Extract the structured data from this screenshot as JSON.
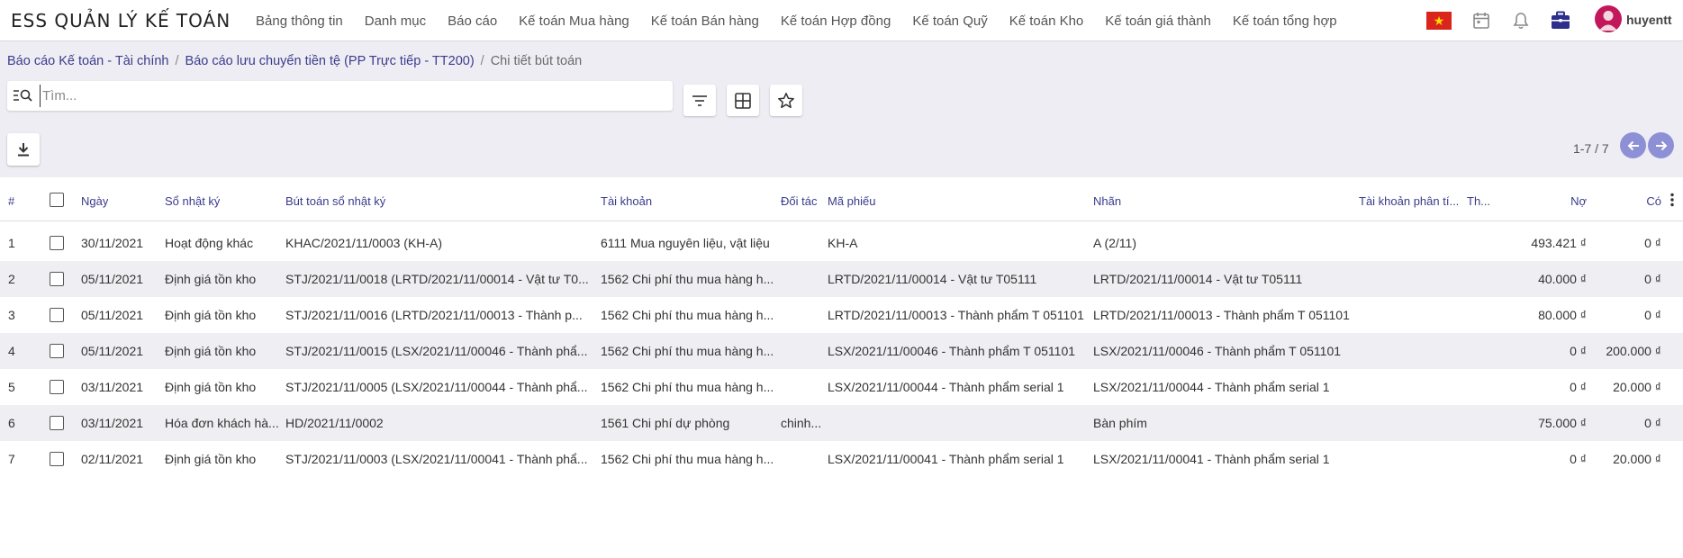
{
  "app": {
    "title": "ESS QUẢN LÝ KẾ TOÁN",
    "username": "huyentt"
  },
  "menu": [
    "Bảng thông tin",
    "Danh mục",
    "Báo cáo",
    "Kế toán Mua hàng",
    "Kế toán Bán hàng",
    "Kế toán Hợp đồng",
    "Kế toán Quỹ",
    "Kế toán Kho",
    "Kế toán giá thành",
    "Kế toán tổng hợp"
  ],
  "icons": {
    "flag": "vietnam-flag-icon",
    "calendar": "calendar-icon",
    "bell": "bell-icon",
    "briefcase": "briefcase-icon",
    "avatar": "user-avatar-icon"
  },
  "colors": {
    "link": "#3c3c8e",
    "pager": "#8e90d6",
    "briefcase": "#2d2d8c",
    "avatar": "#c2185b",
    "flag": "#da251d"
  },
  "breadcrumb": {
    "items": [
      "Báo cáo Kế toán - Tài chính",
      "Báo cáo lưu chuyển tiền tệ (PP Trực tiếp - TT200)"
    ],
    "current": "Chi tiết bút toán",
    "sep": "/"
  },
  "search": {
    "placeholder": "Tìm...",
    "value": ""
  },
  "toolbar": {
    "filter": "filter-icon",
    "group": "grid-icon",
    "favorite": "star-icon",
    "download": "download-icon"
  },
  "pager": {
    "text": "1-7 / 7"
  },
  "table": {
    "headers": {
      "idx": "#",
      "date": "Ngày",
      "journal": "Sổ nhật ký",
      "entry": "Bút toán sổ nhật ký",
      "account": "Tài khoản",
      "partner": "Đối tác",
      "ref": "Mã phiếu",
      "label": "Nhãn",
      "analytic": "Tài khoản phân tí...",
      "tax": "Th...",
      "debit": "Nợ",
      "credit": "Có"
    },
    "rows": [
      {
        "idx": "1",
        "date": "30/11/2021",
        "journal": "Hoạt động khác",
        "entry": "KHAC/2021/11/0003 (KH-A)",
        "account": "6111 Mua nguyên liệu, vật liệu",
        "partner": "",
        "ref": "KH-A",
        "label": "A (2/11)",
        "debit": "493.421 ₫",
        "credit": "0 ₫"
      },
      {
        "idx": "2",
        "date": "05/11/2021",
        "journal": "Định giá tồn kho",
        "entry": "STJ/2021/11/0018 (LRTD/2021/11/00014 - Vật tư T0...",
        "account": "1562 Chi phí thu mua hàng h...",
        "partner": "",
        "ref": "LRTD/2021/11/00014 - Vật tư T05111",
        "label": "LRTD/2021/11/00014 - Vật tư T05111",
        "debit": "40.000 ₫",
        "credit": "0 ₫"
      },
      {
        "idx": "3",
        "date": "05/11/2021",
        "journal": "Định giá tồn kho",
        "entry": "STJ/2021/11/0016 (LRTD/2021/11/00013 - Thành p...",
        "account": "1562 Chi phí thu mua hàng h...",
        "partner": "",
        "ref": "LRTD/2021/11/00013 - Thành phẩm T 051101",
        "label": "LRTD/2021/11/00013 - Thành phẩm T 051101",
        "debit": "80.000 ₫",
        "credit": "0 ₫"
      },
      {
        "idx": "4",
        "date": "05/11/2021",
        "journal": "Định giá tồn kho",
        "entry": "STJ/2021/11/0015 (LSX/2021/11/00046 - Thành phẩ...",
        "account": "1562 Chi phí thu mua hàng h...",
        "partner": "",
        "ref": "LSX/2021/11/00046 - Thành phẩm T 051101",
        "label": "LSX/2021/11/00046 - Thành phẩm T 051101",
        "debit": "0 ₫",
        "credit": "200.000 ₫"
      },
      {
        "idx": "5",
        "date": "03/11/2021",
        "journal": "Định giá tồn kho",
        "entry": "STJ/2021/11/0005 (LSX/2021/11/00044 - Thành phẩ...",
        "account": "1562 Chi phí thu mua hàng h...",
        "partner": "",
        "ref": "LSX/2021/11/00044 - Thành phẩm serial 1",
        "label": "LSX/2021/11/00044 - Thành phẩm serial 1",
        "debit": "0 ₫",
        "credit": "20.000 ₫"
      },
      {
        "idx": "6",
        "date": "03/11/2021",
        "journal": "Hóa đơn khách hà...",
        "entry": "HD/2021/11/0002",
        "account": "1561 Chi phí dự phòng",
        "partner": "chinh...",
        "ref": "",
        "label": "Bàn phím",
        "debit": "75.000 ₫",
        "credit": "0 ₫"
      },
      {
        "idx": "7",
        "date": "02/11/2021",
        "journal": "Định giá tồn kho",
        "entry": "STJ/2021/11/0003 (LSX/2021/11/00041 - Thành phẩ...",
        "account": "1562 Chi phí thu mua hàng h...",
        "partner": "",
        "ref": "LSX/2021/11/00041 - Thành phẩm serial 1",
        "label": "LSX/2021/11/00041 - Thành phẩm serial 1",
        "debit": "0 ₫",
        "credit": "20.000 ₫"
      }
    ]
  }
}
